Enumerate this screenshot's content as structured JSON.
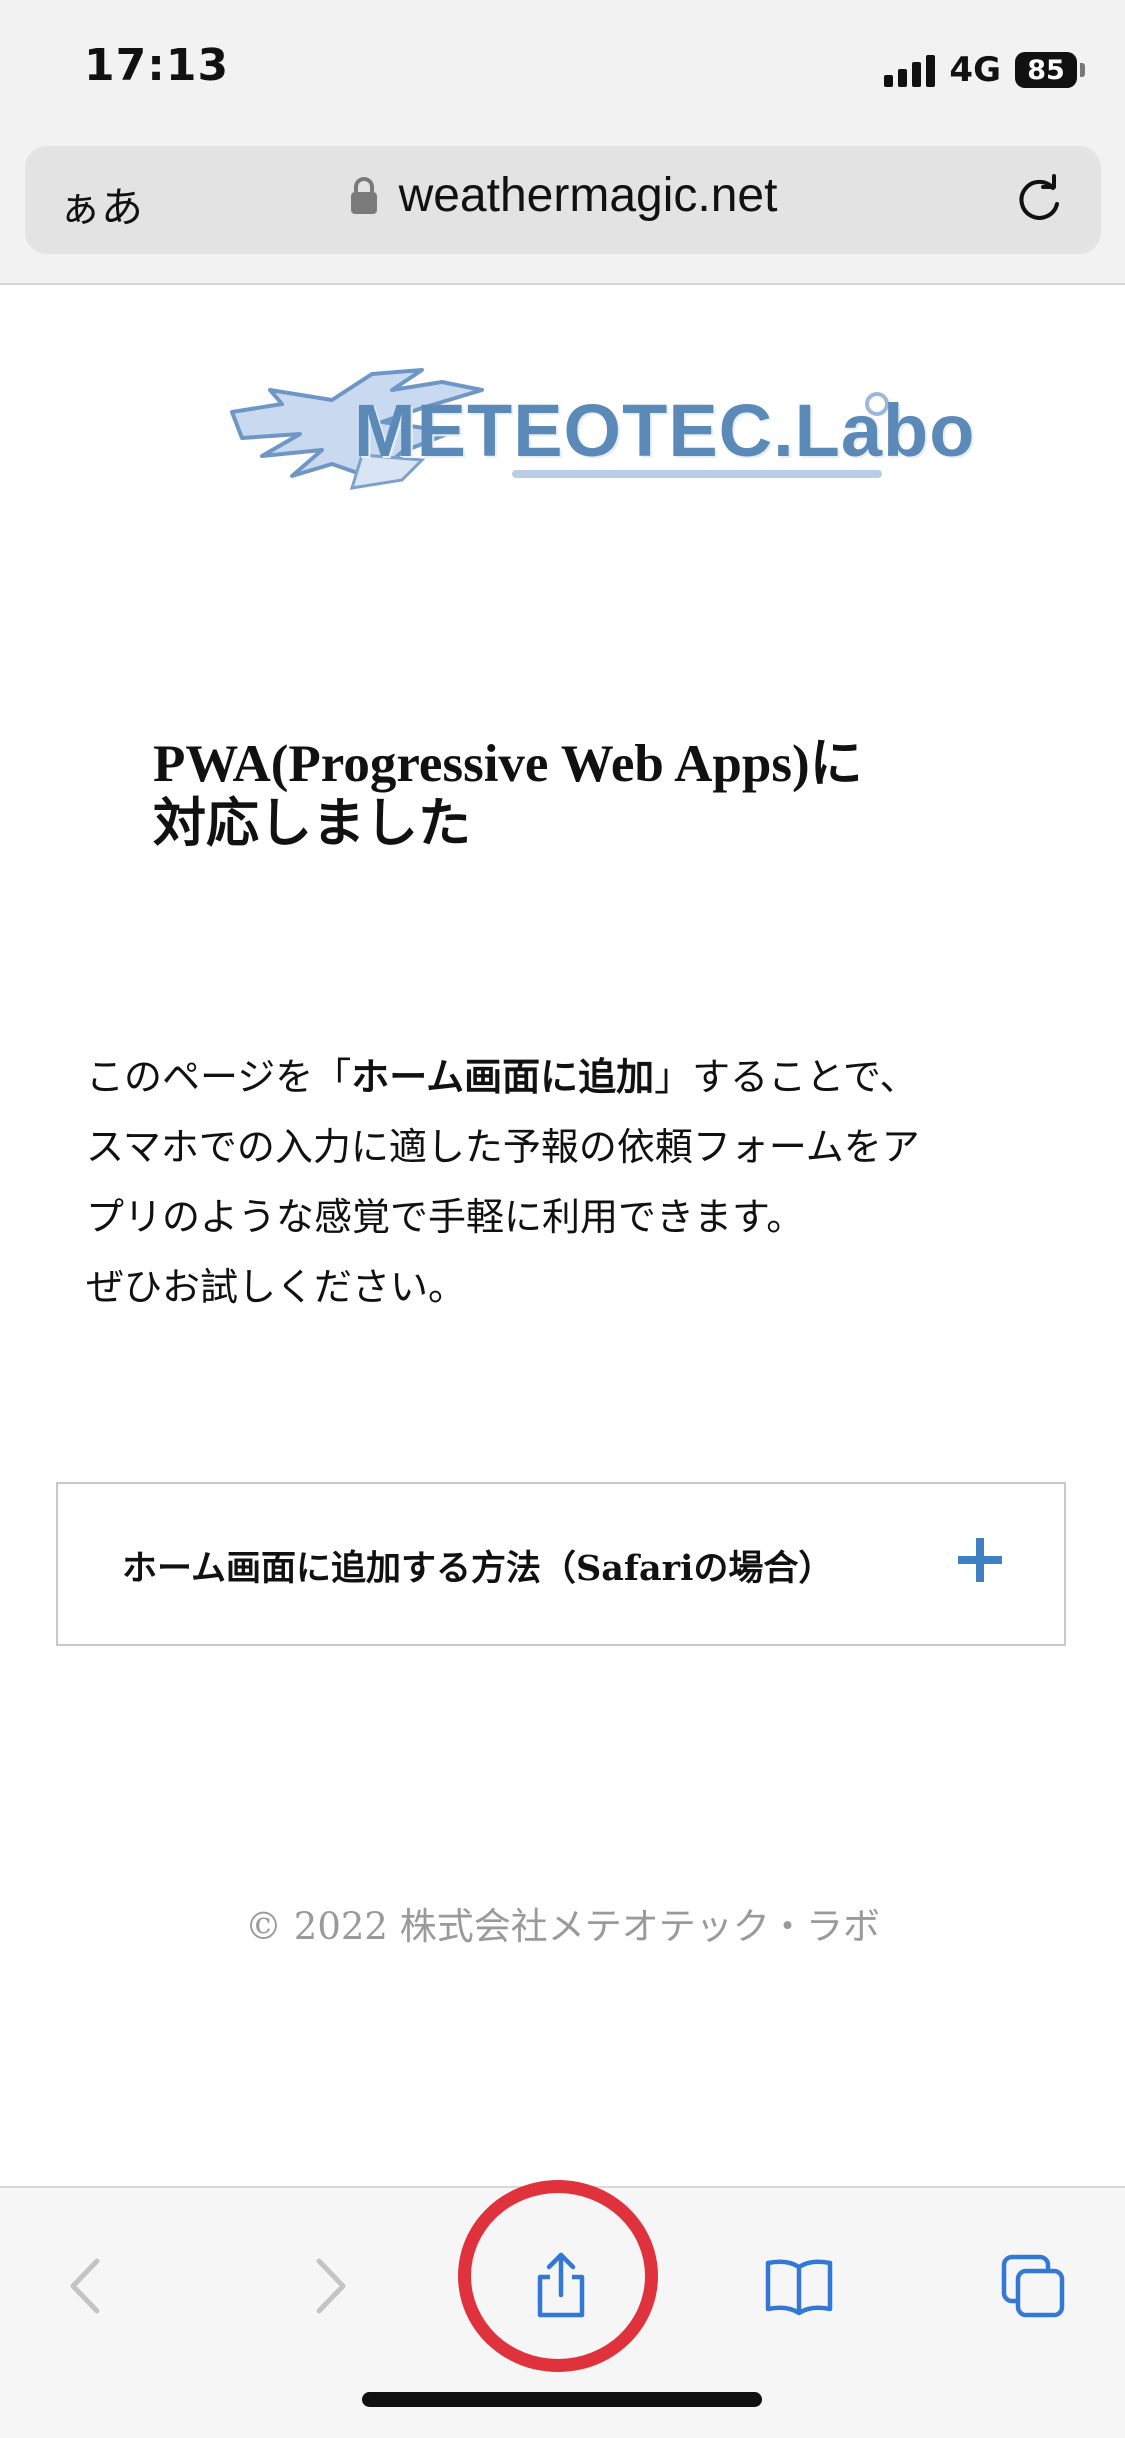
{
  "status_bar": {
    "time": "17:13",
    "network": "4G",
    "battery": "85"
  },
  "address_bar": {
    "text_size_label": "ぁあ",
    "url": "weathermagic.net",
    "icons": [
      "lock-icon",
      "reload-icon"
    ]
  },
  "page": {
    "logo_text": "METEOTEC.Labo",
    "headline_line1": "PWA(Progressive Web Apps)に",
    "headline_line2": "対応しました",
    "body": {
      "line1_prefix": "このページを「",
      "line1_bold": "ホーム画面に追加",
      "line1_suffix": "」することで、",
      "line2": "スマホでの入力に適した予報の依頼フォームをア",
      "line3": "プリのような感覚で手軽に利用できます。",
      "line4": "ぜひお試しください。"
    },
    "accordion_label": "ホーム画面に追加する方法（Safariの場合）",
    "footer_copyright": "© 2022 株式会社メテオテック・ラボ"
  },
  "toolbar": {
    "icons": [
      "back-icon",
      "forward-icon",
      "share-icon",
      "bookmarks-icon",
      "tabs-icon"
    ]
  },
  "colors": {
    "accent_blue": "#3f7fc4",
    "toolbar_icon_blue": "#3478d6",
    "highlight_red": "#e0323d",
    "logo_blue": "#5b89b8"
  }
}
